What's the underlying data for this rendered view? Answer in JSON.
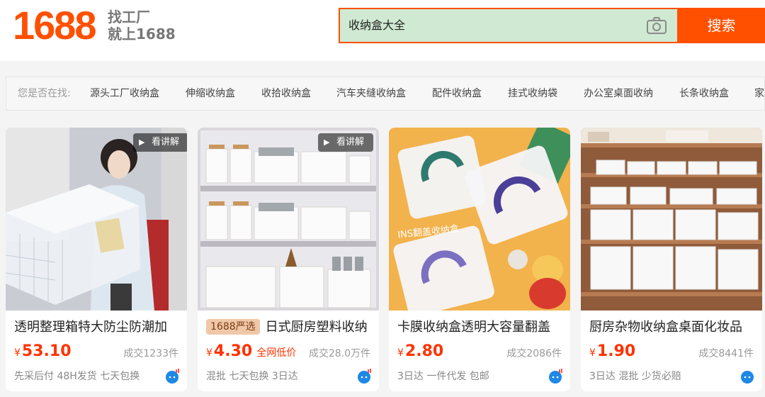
{
  "header": {
    "logo": "1688",
    "slogan_line1": "找工厂",
    "slogan_line2": "就上1688",
    "search_value": "收纳盒大全",
    "search_button": "搜索",
    "camera_icon": "camera-icon"
  },
  "suggest": {
    "label": "您是否在找:",
    "items": [
      "源头工厂收纳盒",
      "伸缩收纳盒",
      "收拾收纳盒",
      "汽车夹缝收纳盒",
      "配件收纳盒",
      "挂式收纳袋",
      "办公室桌面收纳",
      "长条收纳盒",
      "家"
    ]
  },
  "cards": [
    {
      "video_label": "看讲解",
      "title": "透明整理箱特大防尘防潮加",
      "yen": "¥",
      "price": "53.10",
      "low": "",
      "sold": "成交1233件",
      "tags": "先采后付 48H发货 七天包换"
    },
    {
      "video_label": "看讲解",
      "badge": "1688严选",
      "title": "日式厨房塑料收纳",
      "yen": "¥",
      "price": "4.30",
      "low": "全网低价",
      "sold": "成交28.0万件",
      "tags": "混批 七天包换 3日达"
    },
    {
      "title": "卡膜收纳盒透明大容量翻盖",
      "yen": "¥",
      "price": "2.80",
      "low": "",
      "sold": "成交2086件",
      "tags": "3日达 一件代发 包邮",
      "image_text": "INS翻盖收纳盒"
    },
    {
      "title": "厨房杂物收纳盒桌面化妆品",
      "yen": "¥",
      "price": "1.90",
      "low": "",
      "sold": "成交8441件",
      "tags": "3日达 混批 少货必赔"
    }
  ],
  "colors": {
    "brand": "#ff5000",
    "price": "#ff3300",
    "search_bg": "#cfe9d2"
  }
}
